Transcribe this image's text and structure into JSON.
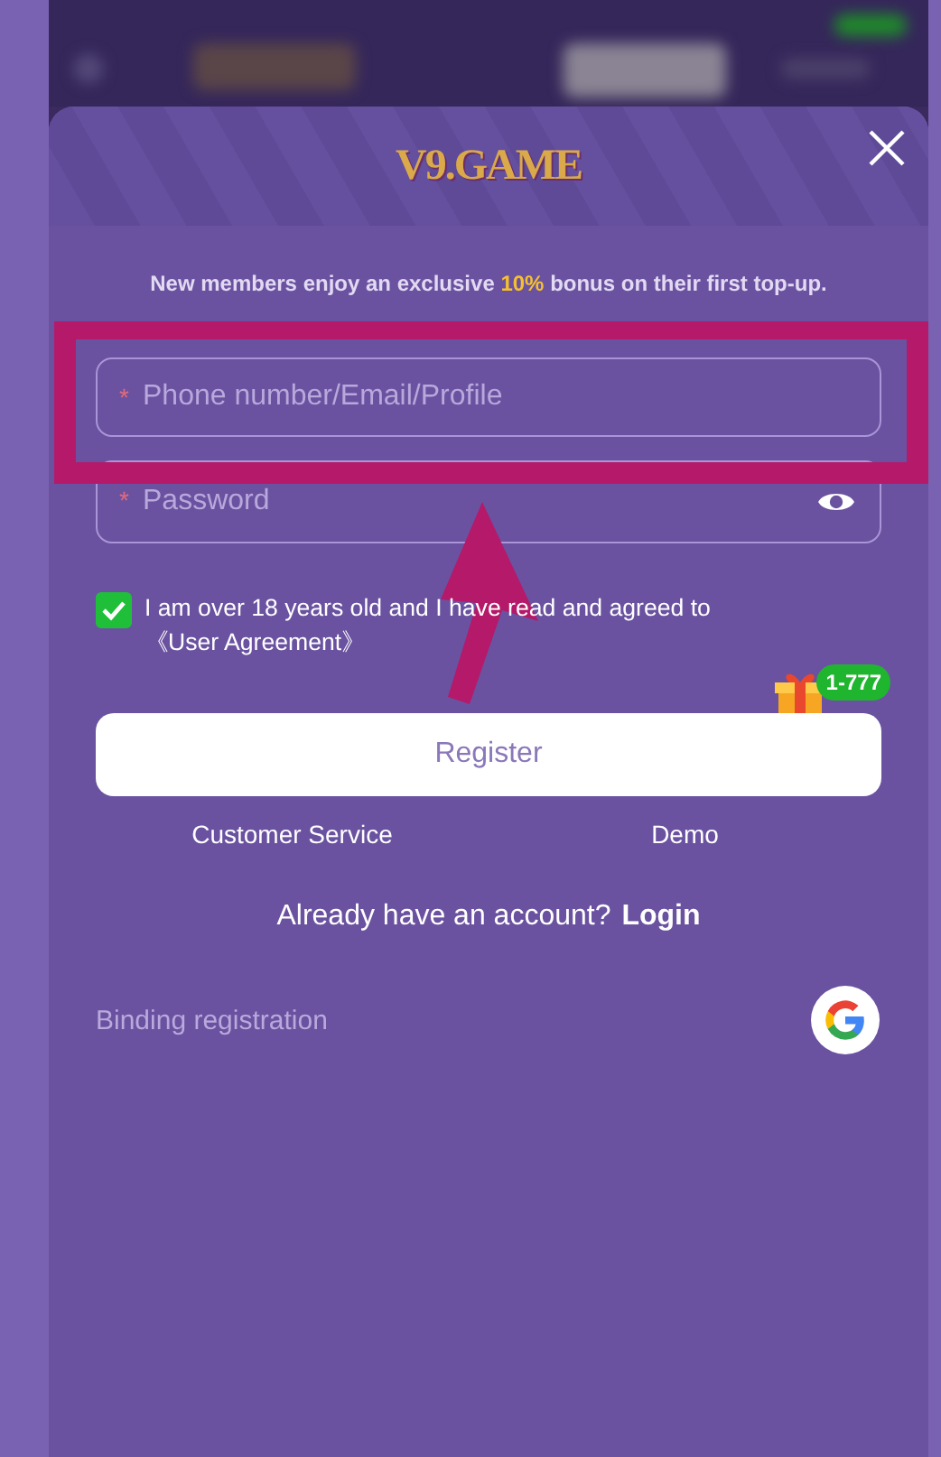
{
  "logo": "V9.GAME",
  "notice": "New members enjoy an exclusive **10%** bonus on their first top-up.",
  "fields": [
    {
      "kind": "text",
      "required_mark": "*",
      "placeholder": "Phone number/Email/Profile"
    },
    {
      "kind": "password",
      "required_mark": "*",
      "placeholder": "Password"
    }
  ],
  "agreement": {
    "checked": true,
    "text": "I am over 18 years old and I have read and agreed to ",
    "link": "《User Agreement》"
  },
  "gift_badge": "1-777",
  "register_button": "Register",
  "links": [
    "Customer Service",
    "Demo"
  ],
  "account_prompt": "Already have an account?",
  "login_link": "Login",
  "binding_label": "Binding registration"
}
